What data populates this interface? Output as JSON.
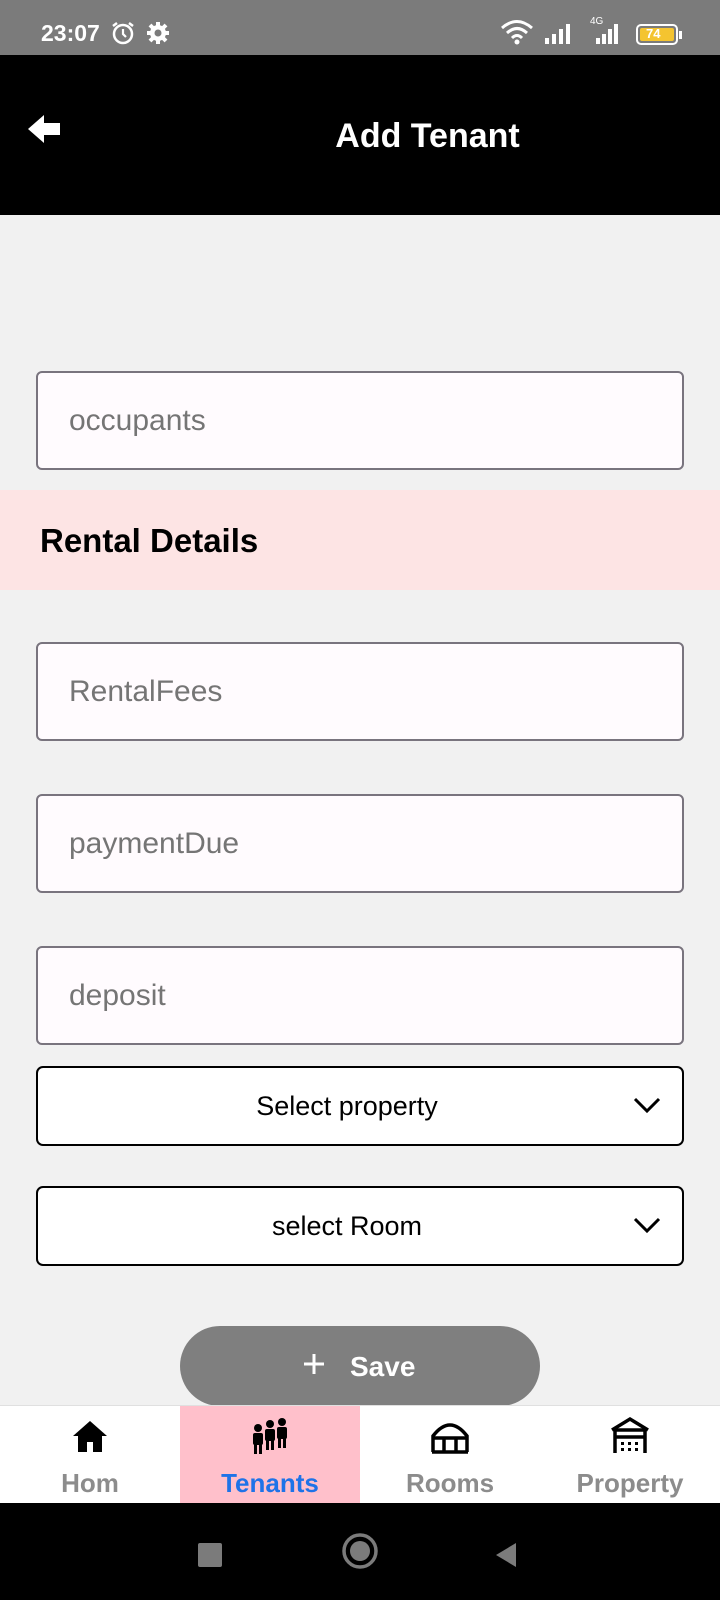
{
  "status_bar": {
    "time": "23:07",
    "battery": "74",
    "network": "4G",
    "icons": [
      "alarm-icon",
      "settings-icon",
      "wifi-icon",
      "signal-icon",
      "signal-4g-icon",
      "battery-icon"
    ]
  },
  "app_bar": {
    "title": "Add Tenant",
    "back_icon": "back-arrow-icon"
  },
  "form": {
    "occupants_placeholder": "occupants",
    "section_title": "Rental Details",
    "rental_fees_placeholder": "RentalFees",
    "payment_due_placeholder": "paymentDue",
    "deposit_placeholder": "deposit",
    "property_select": "Select property",
    "room_select": "select Room",
    "save_label": "Save",
    "save_icon": "plus-icon"
  },
  "bottom_nav": {
    "items": [
      {
        "label": "Hom",
        "icon": "home-icon",
        "active": false
      },
      {
        "label": "Tenants",
        "icon": "tenants-icon",
        "active": true
      },
      {
        "label": "Rooms",
        "icon": "rooms-icon",
        "active": false
      },
      {
        "label": "Property",
        "icon": "property-icon",
        "active": false
      }
    ]
  },
  "colors": {
    "app_bar": "#000000",
    "section_band": "#fde4e4",
    "active_nav_bg": "#ffc0cb",
    "active_nav_text": "#1e73e8",
    "save_button": "#7f7f7f"
  }
}
